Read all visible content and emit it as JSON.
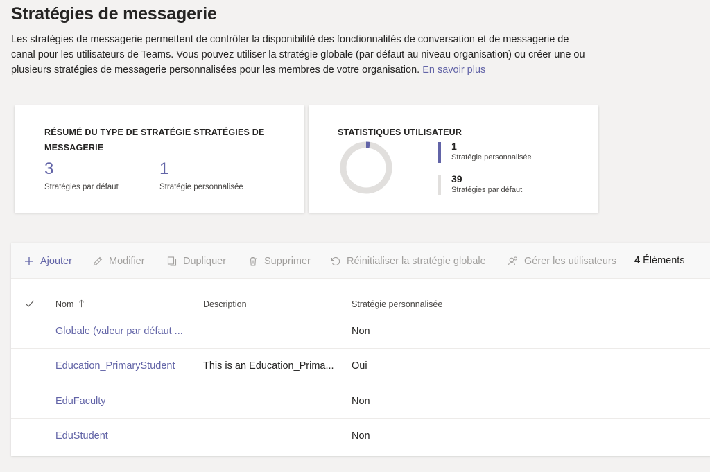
{
  "page": {
    "title": "Stratégies de messagerie",
    "description": "Les stratégies de messagerie permettent de contrôler la disponibilité des fonctionnalités de conversation et de messagerie de canal pour les utilisateurs de Teams. Vous pouvez utiliser la stratégie globale (par défaut au niveau organisation) ou créer une ou plusieurs stratégies de messagerie personnalisées pour les membres de votre organisation.",
    "learn_more": "En savoir plus"
  },
  "summary_card": {
    "title": "Résumé du type de stratégie Stratégies de messagerie",
    "default_count": "3",
    "default_label": "Stratégies par défaut",
    "custom_count": "1",
    "custom_label": "Stratégie personnalisée"
  },
  "stats_card": {
    "title": "Statistiques utilisateur",
    "custom_users": "1",
    "custom_label": "Stratégie personnalisée",
    "default_users": "39",
    "default_label": "Stratégies par défaut",
    "custom_color": "#6264a7",
    "default_color": "#e1dfdd"
  },
  "toolbar": {
    "add": "Ajouter",
    "edit": "Modifier",
    "duplicate": "Dupliquer",
    "delete": "Supprimer",
    "reset": "Réinitialiser la stratégie globale",
    "manage_users": "Gérer les utilisateurs",
    "count_number": "4",
    "count_label": "Éléments"
  },
  "table": {
    "columns": {
      "name": "Nom",
      "description": "Description",
      "custom": "Stratégie personnalisée"
    },
    "rows": [
      {
        "name": "Globale (valeur par défaut ...",
        "description": "",
        "custom": "Non"
      },
      {
        "name": "Education_PrimaryStudent",
        "description": "This is an Education_Prima...",
        "custom": "Oui"
      },
      {
        "name": "EduFaculty",
        "description": "",
        "custom": "Non"
      },
      {
        "name": "EduStudent",
        "description": "",
        "custom": "Non"
      }
    ]
  },
  "colors": {
    "accent": "#6264a7",
    "disabled": "#a19f9d"
  }
}
